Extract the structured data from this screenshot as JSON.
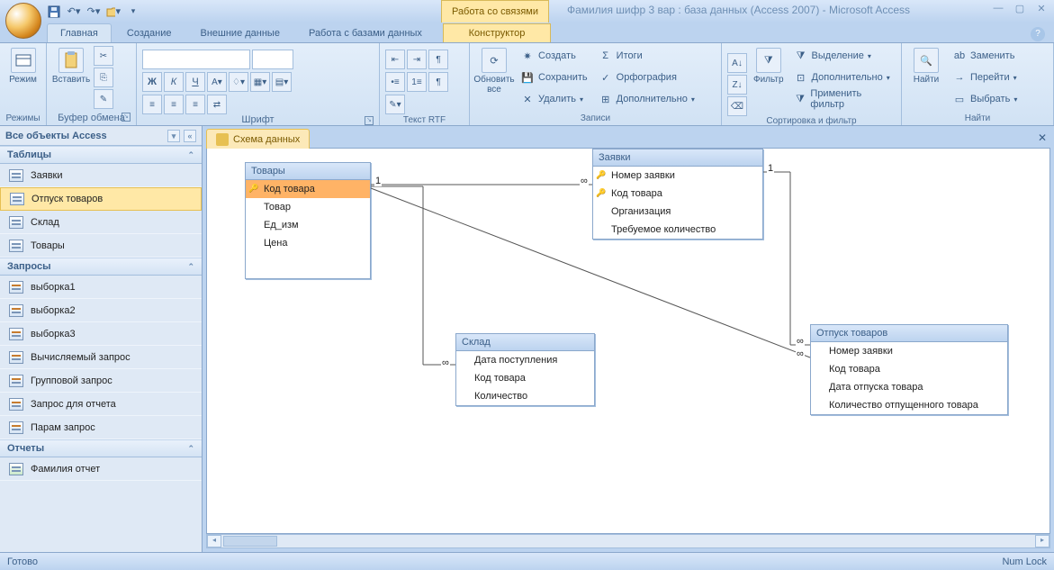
{
  "title": "Фамилия шифр 3 вар : база данных (Access 2007) - Microsoft Access",
  "context_tab_group": "Работа со связями",
  "tabs": {
    "home": "Главная",
    "create": "Создание",
    "external": "Внешние данные",
    "dbtools": "Работа с базами данных",
    "designer": "Конструктор"
  },
  "ribbon": {
    "views": {
      "label": "Режимы",
      "btn": "Режим"
    },
    "clipboard": {
      "label": "Буфер обмена",
      "paste": "Вставить"
    },
    "font": {
      "label": "Шрифт"
    },
    "rtf": {
      "label": "Текст RTF"
    },
    "records": {
      "label": "Записи",
      "refresh": "Обновить все",
      "new": "Создать",
      "save": "Сохранить",
      "delete": "Удалить",
      "totals": "Итоги",
      "spelling": "Орфография",
      "more": "Дополнительно"
    },
    "sortfilter": {
      "label": "Сортировка и фильтр",
      "filter": "Фильтр",
      "selection": "Выделение",
      "advanced": "Дополнительно",
      "toggle": "Применить фильтр"
    },
    "find": {
      "label": "Найти",
      "find": "Найти",
      "replace": "Заменить",
      "goto": "Перейти",
      "select": "Выбрать"
    }
  },
  "nav": {
    "title": "Все объекты Access",
    "groups": {
      "tables": "Таблицы",
      "queries": "Запросы",
      "reports": "Отчеты"
    },
    "tables": [
      "Заявки",
      "Отпуск товаров",
      "Склад",
      "Товары"
    ],
    "queries": [
      "выборка1",
      "выборка2",
      "выборка3",
      "Вычисляемый запрос",
      "Групповой запрос",
      "Запрос для отчета",
      "Парам запрос"
    ],
    "reports": [
      "Фамилия отчет"
    ]
  },
  "doc_tab": "Схема данных",
  "diagram": {
    "t1": {
      "title": "Товары",
      "fields": [
        "Код товара",
        "Товар",
        "Ед_изм",
        "Цена"
      ]
    },
    "t2": {
      "title": "Заявки",
      "fields": [
        "Номер заявки",
        "Код товара",
        "Организация",
        "Требуемое количество"
      ]
    },
    "t3": {
      "title": "Склад",
      "fields": [
        "Дата поступления",
        "Код товара",
        "Количество"
      ]
    },
    "t4": {
      "title": "Отпуск товаров",
      "fields": [
        "Номер заявки",
        "Код товара",
        "Дата отпуска товара",
        "Количество отпущенного товара"
      ]
    },
    "one": "1",
    "inf": "∞"
  },
  "status": {
    "ready": "Готово",
    "numlock": "Num Lock"
  }
}
